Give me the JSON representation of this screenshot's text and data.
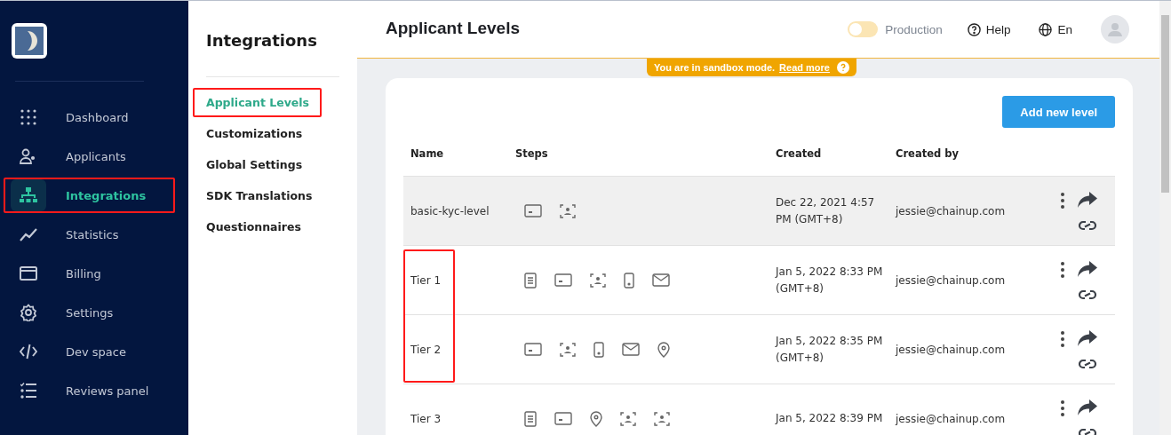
{
  "sidebar": {
    "items": [
      {
        "kind": "dots",
        "label": "Dashboard",
        "selected": false,
        "highlighted": false
      },
      {
        "kind": "users",
        "label": "Applicants",
        "selected": false,
        "highlighted": false
      },
      {
        "kind": "tree",
        "label": "Integrations",
        "selected": true,
        "highlighted": true
      },
      {
        "kind": "chart",
        "label": "Statistics",
        "selected": false,
        "highlighted": false
      },
      {
        "kind": "card",
        "label": "Billing",
        "selected": false,
        "highlighted": false
      },
      {
        "kind": "gear",
        "label": "Settings",
        "selected": false,
        "highlighted": false
      },
      {
        "kind": "code",
        "label": "Dev space",
        "selected": false,
        "highlighted": false
      },
      {
        "kind": "list",
        "label": "Reviews panel",
        "selected": false,
        "highlighted": false
      }
    ]
  },
  "submenu": {
    "title": "Integrations",
    "items": [
      {
        "label": "Applicant Levels",
        "selected": true,
        "highlighted": true
      },
      {
        "label": "Customizations",
        "selected": false,
        "highlighted": false
      },
      {
        "label": "Global Settings",
        "selected": false,
        "highlighted": false
      },
      {
        "label": "SDK Translations",
        "selected": false,
        "highlighted": false
      },
      {
        "label": "Questionnaires",
        "selected": false,
        "highlighted": false
      }
    ]
  },
  "header": {
    "title": "Applicant Levels",
    "production": {
      "label": "Production",
      "on": false
    },
    "help": "Help",
    "language": "En"
  },
  "banner": {
    "text": "You are in sandbox mode.",
    "link": "Read more"
  },
  "add_button": "Add new level",
  "table": {
    "columns": [
      "Name",
      "Steps",
      "Created",
      "Created by"
    ],
    "rows": [
      {
        "name": "basic-kyc-level",
        "steps": [
          {
            "kind": "id"
          },
          {
            "kind": "face"
          }
        ],
        "created": "Dec 22, 2021 4:57 PM (GMT+8)",
        "created_by": "jessie@chainup.com",
        "selected": true,
        "highlighted": false
      },
      {
        "name": "Tier 1",
        "steps": [
          {
            "kind": "doc"
          },
          {
            "kind": "id"
          },
          {
            "kind": "face"
          },
          {
            "kind": "phone"
          },
          {
            "kind": "mail"
          }
        ],
        "created": "Jan 5, 2022 8:33 PM (GMT+8)",
        "created_by": "jessie@chainup.com",
        "selected": false,
        "highlighted": true
      },
      {
        "name": "Tier 2",
        "steps": [
          {
            "kind": "id"
          },
          {
            "kind": "face"
          },
          {
            "kind": "phone"
          },
          {
            "kind": "mail"
          },
          {
            "kind": "pin"
          }
        ],
        "created": "Jan 5, 2022 8:35 PM (GMT+8)",
        "created_by": "jessie@chainup.com",
        "selected": false,
        "highlighted": true
      },
      {
        "name": "Tier 3",
        "steps": [
          {
            "kind": "doc"
          },
          {
            "kind": "id"
          },
          {
            "kind": "pin"
          },
          {
            "kind": "face"
          },
          {
            "kind": "face"
          }
        ],
        "created": "Jan 5, 2022 8:39 PM",
        "created_by": "jessie@chainup.com",
        "selected": false,
        "highlighted": false
      }
    ]
  }
}
